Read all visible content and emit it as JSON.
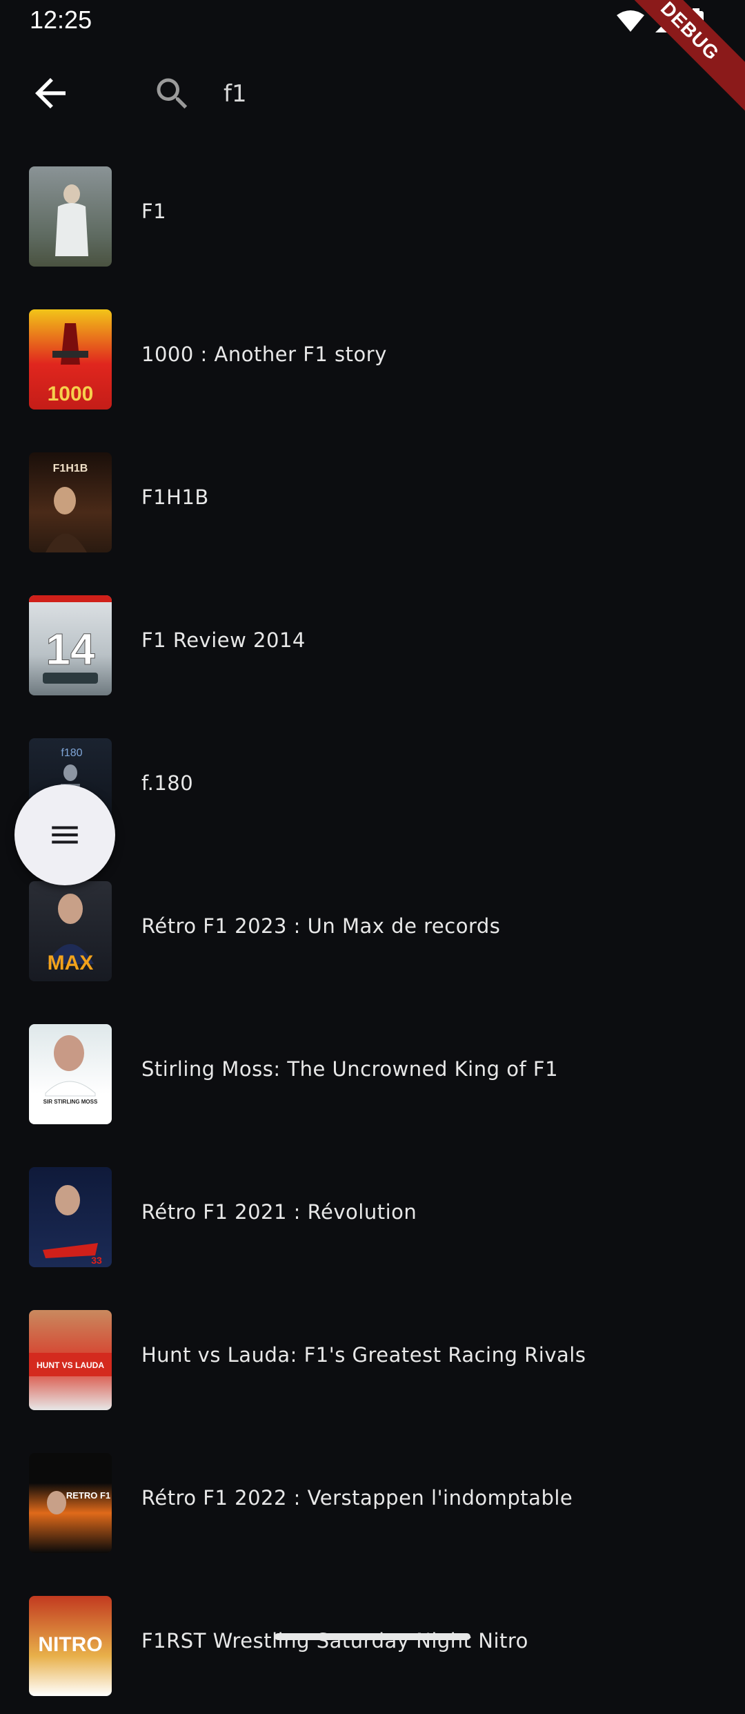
{
  "status_bar": {
    "time": "12:25"
  },
  "debug_banner": {
    "label": "DEBUG"
  },
  "search": {
    "query": "f1",
    "placeholder": ""
  },
  "results": [
    {
      "title": "F1"
    },
    {
      "title": "1000 : Another F1 story"
    },
    {
      "title": "F1H1B"
    },
    {
      "title": "F1 Review 2014"
    },
    {
      "title": "f.180"
    },
    {
      "title": "Rétro F1 2023 : Un Max de records"
    },
    {
      "title": "Stirling Moss: The Uncrowned King of F1"
    },
    {
      "title": "Rétro F1 2021 : Révolution"
    },
    {
      "title": "Hunt vs Lauda: F1's Greatest Racing Rivals"
    },
    {
      "title": "Rétro F1 2022 : Verstappen l'indomptable"
    },
    {
      "title": "F1RST Wrestling Saturday Night Nitro"
    }
  ],
  "thumbnails": [
    {
      "text": ""
    },
    {
      "text": "1000"
    },
    {
      "text": "F1H1B"
    },
    {
      "text": "14"
    },
    {
      "text": "f180"
    },
    {
      "text": "MAX"
    },
    {
      "text": "SIR STIRLING MOSS"
    },
    {
      "text": "33"
    },
    {
      "text": "HUNT VS LAUDA"
    },
    {
      "text": "RETRO F1"
    },
    {
      "text": "NITRO"
    }
  ],
  "icons": {
    "back": "arrow-left-icon",
    "search": "search-icon",
    "menu": "menu-icon",
    "wifi": "wifi-icon",
    "signal": "signal-icon",
    "battery": "battery-icon"
  },
  "colors": {
    "background": "#0c0d10",
    "text": "#e8e8e8",
    "fab": "#efeff4",
    "debug": "#8b1a1a"
  }
}
